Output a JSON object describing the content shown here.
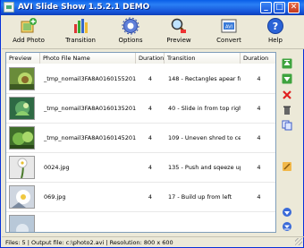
{
  "window": {
    "title": "AVI Slide Show 1.5.2.1 DEMO"
  },
  "toolbar": [
    {
      "label": "Add Photo",
      "icon": "add-photo-icon"
    },
    {
      "label": "Transition",
      "icon": "transition-icon"
    },
    {
      "label": "Options",
      "icon": "options-gear-icon"
    },
    {
      "label": "Preview",
      "icon": "preview-icon"
    },
    {
      "label": "Convert",
      "icon": "convert-icon"
    },
    {
      "label": "Help",
      "icon": "help-icon"
    }
  ],
  "grid": {
    "columns": [
      "Preview",
      "Photo File Name",
      "Duration",
      "Transition",
      "Duration"
    ],
    "rows": [
      {
        "file": "_tmp_nomail3FA8A0160155201.jpg",
        "duration": "4",
        "transition": "148 - Rectangles apear fro...",
        "tduration": "4"
      },
      {
        "file": "_tmp_nomail3FA8A0160135201.jpg",
        "duration": "4",
        "transition": "40 - Slide in from top right",
        "tduration": "4"
      },
      {
        "file": "_tmp_nomail3FA8A0160145201.jpg",
        "duration": "4",
        "transition": "109 - Uneven shred to cen...",
        "tduration": "4"
      },
      {
        "file": "0024.jpg",
        "duration": "4",
        "transition": "135 - Push and sqeeze up",
        "tduration": "4"
      },
      {
        "file": "069.jpg",
        "duration": "4",
        "transition": "17 - Build up from left",
        "tduration": "4"
      }
    ]
  },
  "side_buttons": [
    "move-top-icon",
    "move-up-icon",
    "remove-icon",
    "delete-icon",
    "copy-icon",
    "edit-icon",
    "move-down-icon",
    "move-bottom-icon"
  ],
  "status": {
    "text": "Files: 5 | Output file: c:\\photo2.avi | Resolution: 800 x 600"
  }
}
